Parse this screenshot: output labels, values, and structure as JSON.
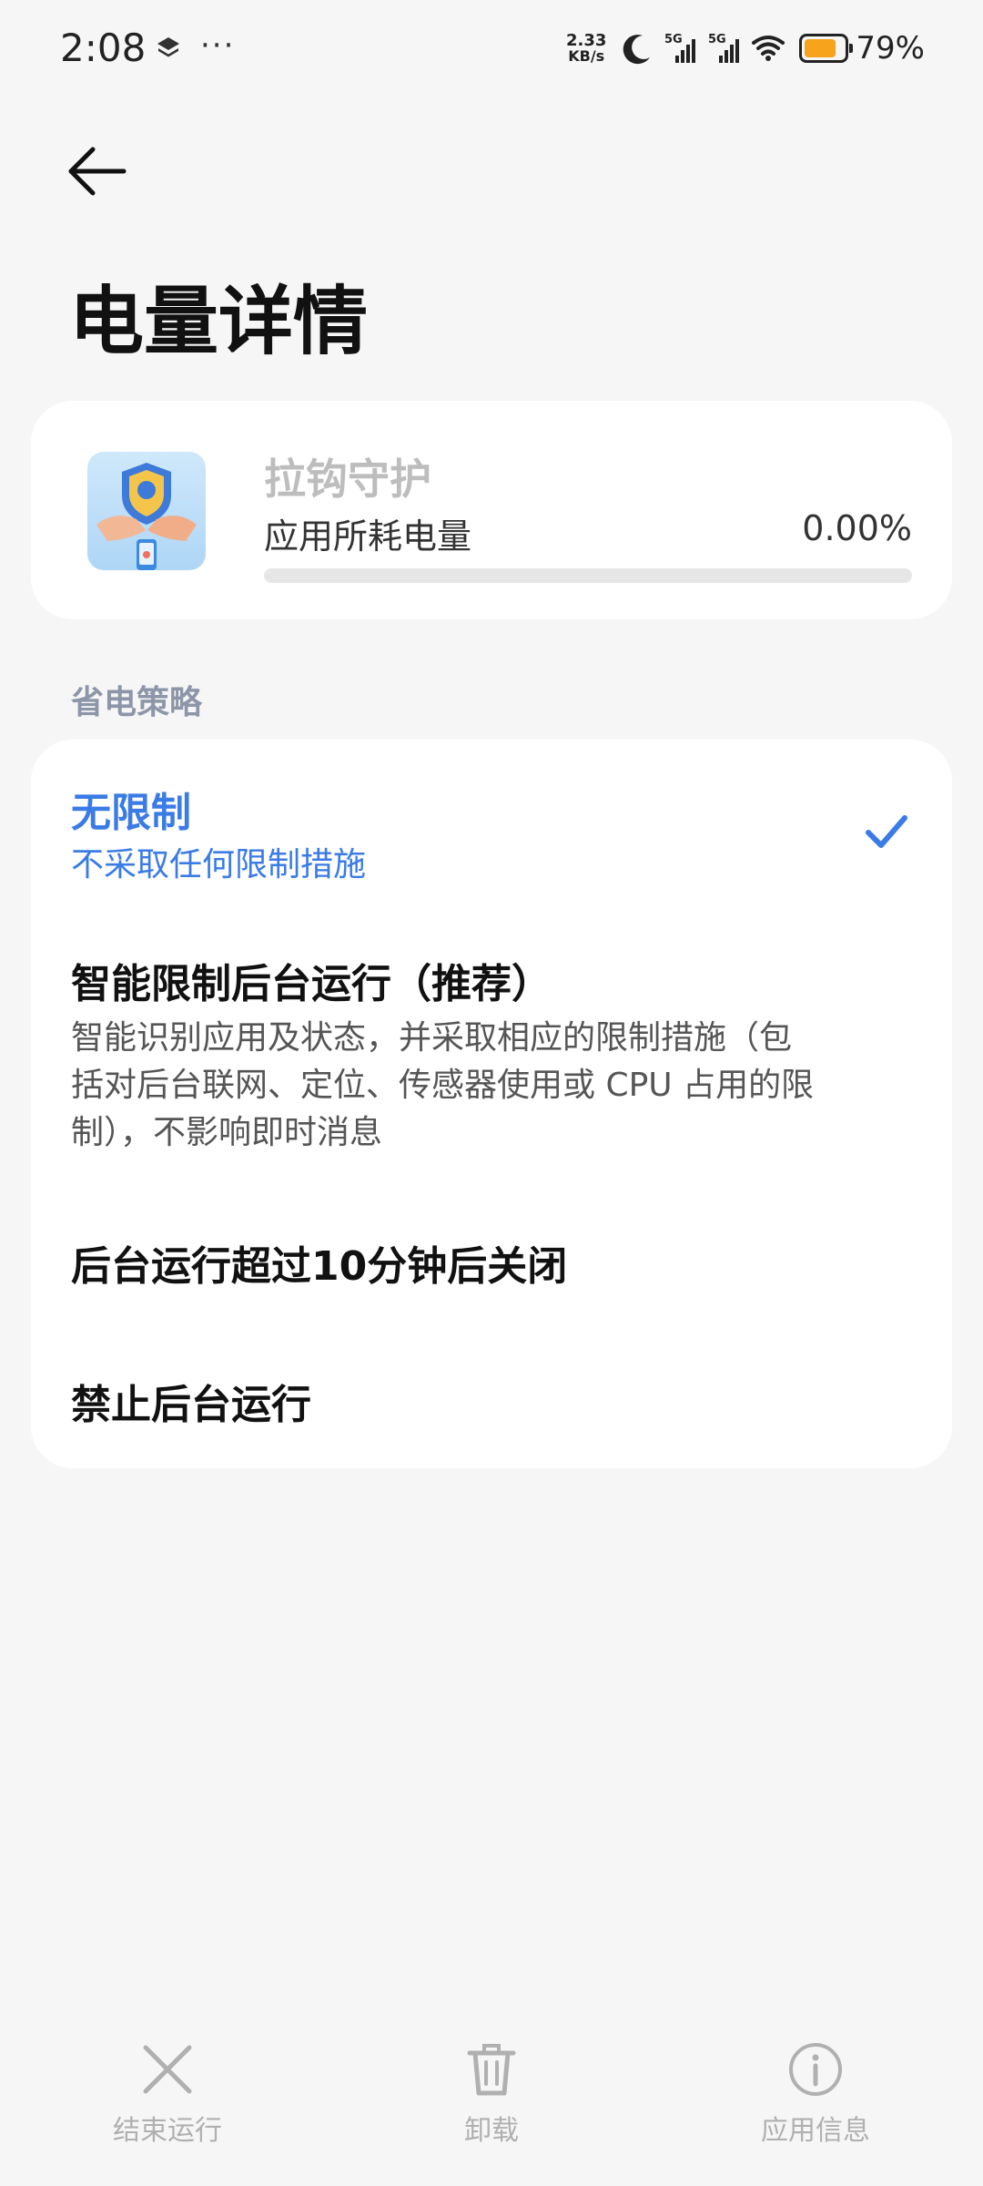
{
  "status_bar": {
    "time": "2:08",
    "more": "···",
    "net_speed_value": "2.33",
    "net_speed_unit": "KB/s",
    "signal1_label": "5G",
    "signal2_label": "5G",
    "battery_percent_text": "79%",
    "battery_level": 0.79,
    "battery_color": "#f7a31b"
  },
  "header": {
    "title": "电量详情"
  },
  "app_card": {
    "app_name": "拉钩守护",
    "usage_label": "应用所耗电量",
    "usage_value": "0.00%",
    "usage_fraction": 0.0
  },
  "policy": {
    "section_title": "省电策略",
    "options": [
      {
        "title": "无限制",
        "subtitle": "不采取任何限制措施",
        "selected": true
      },
      {
        "title": "智能限制后台运行（推荐）",
        "subtitle": "智能识别应用及状态，并采取相应的限制措施（包括对后台联网、定位、传感器使用或 CPU 占用的限制），不影响即时消息",
        "selected": false
      },
      {
        "title": "后台运行超过10分钟后关闭",
        "subtitle": "",
        "selected": false
      },
      {
        "title": "禁止后台运行",
        "subtitle": "",
        "selected": false
      }
    ],
    "accent_color": "#3a7be6"
  },
  "bottom_bar": {
    "items": [
      {
        "label": "结束运行",
        "icon": "close-icon"
      },
      {
        "label": "卸载",
        "icon": "trash-icon"
      },
      {
        "label": "应用信息",
        "icon": "info-icon"
      }
    ]
  }
}
